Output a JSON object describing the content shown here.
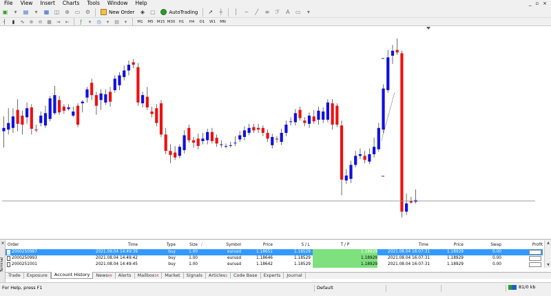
{
  "menu": {
    "items": [
      "File",
      "View",
      "Insert",
      "Charts",
      "Tools",
      "Window",
      "Help"
    ],
    "window_controls": [
      "_",
      "▫",
      "×"
    ]
  },
  "toolbar": {
    "new_order_label": "New Order",
    "autotrading_label": "AutoTrading",
    "timeframes": [
      "M1",
      "M5",
      "M15",
      "M30",
      "H1",
      "H4",
      "D1",
      "W1",
      "MN"
    ]
  },
  "chart": {
    "colors": {
      "bull": "#1010e0",
      "bear": "#ee1111",
      "background": "#ffffff",
      "line": "#8c8c8c"
    },
    "candles": [
      {
        "o": 183.2,
        "c": 183.6,
        "h": 185.0,
        "l": 181.2
      },
      {
        "o": 183.4,
        "c": 184.2,
        "h": 186.0,
        "l": 182.8
      },
      {
        "o": 183.6,
        "c": 185.0,
        "h": 186.0,
        "l": 183.0
      },
      {
        "o": 185.8,
        "c": 184.1,
        "h": 187.1,
        "l": 183.2
      },
      {
        "o": 185.1,
        "c": 184.0,
        "h": 185.7,
        "l": 182.8
      },
      {
        "o": 184.9,
        "c": 186.0,
        "h": 186.7,
        "l": 184.1
      },
      {
        "o": 186.1,
        "c": 183.5,
        "h": 186.5,
        "l": 182.8
      },
      {
        "o": 183.4,
        "c": 183.3,
        "h": 184.0,
        "l": 183.1
      },
      {
        "o": 184.2,
        "c": 185.1,
        "h": 185.6,
        "l": 183.8
      },
      {
        "o": 183.9,
        "c": 185.4,
        "h": 186.3,
        "l": 183.6
      },
      {
        "o": 184.7,
        "c": 187.2,
        "h": 187.5,
        "l": 184.4
      },
      {
        "o": 185.4,
        "c": 187.6,
        "h": 188.7,
        "l": 185.2
      },
      {
        "o": 187.0,
        "c": 185.5,
        "h": 187.5,
        "l": 185.2
      },
      {
        "o": 186.2,
        "c": 185.7,
        "h": 186.5,
        "l": 185.3
      },
      {
        "o": 185.9,
        "c": 186.1,
        "h": 186.5,
        "l": 185.7
      },
      {
        "o": 185.1,
        "c": 185.6,
        "h": 186.2,
        "l": 184.9
      },
      {
        "o": 186.3,
        "c": 184.0,
        "h": 186.6,
        "l": 183.7
      },
      {
        "o": 186.6,
        "c": 186.8,
        "h": 187.0,
        "l": 185.5
      },
      {
        "o": 187.3,
        "c": 188.3,
        "h": 188.6,
        "l": 186.7
      },
      {
        "o": 189.1,
        "c": 187.6,
        "h": 189.6,
        "l": 187.0
      },
      {
        "o": 187.6,
        "c": 186.3,
        "h": 188.0,
        "l": 185.2
      },
      {
        "o": 187.0,
        "c": 187.8,
        "h": 188.3,
        "l": 185.8
      },
      {
        "o": 186.7,
        "c": 187.7,
        "h": 188.3,
        "l": 186.4
      },
      {
        "o": 188.0,
        "c": 186.8,
        "h": 188.6,
        "l": 186.2
      },
      {
        "o": 188.2,
        "c": 189.6,
        "h": 190.0,
        "l": 187.9
      },
      {
        "o": 188.8,
        "c": 190.0,
        "h": 190.4,
        "l": 188.2
      },
      {
        "o": 189.8,
        "c": 190.6,
        "h": 191.2,
        "l": 189.4
      },
      {
        "o": 190.6,
        "c": 191.3,
        "h": 191.8,
        "l": 190.0
      },
      {
        "o": 191.6,
        "c": 191.3,
        "h": 192.0,
        "l": 190.9
      },
      {
        "o": 191.0,
        "c": 186.7,
        "h": 191.5,
        "l": 186.3
      },
      {
        "o": 186.6,
        "c": 187.6,
        "h": 188.0,
        "l": 186.1
      },
      {
        "o": 187.4,
        "c": 186.1,
        "h": 188.6,
        "l": 185.8
      },
      {
        "o": 185.6,
        "c": 185.3,
        "h": 186.2,
        "l": 184.9
      },
      {
        "o": 186.0,
        "c": 184.2,
        "h": 186.5,
        "l": 183.8
      },
      {
        "o": 186.6,
        "c": 182.8,
        "h": 187.0,
        "l": 182.5
      },
      {
        "o": 182.8,
        "c": 180.8,
        "h": 183.6,
        "l": 180.4
      },
      {
        "o": 180.8,
        "c": 180.3,
        "h": 181.6,
        "l": 179.3
      },
      {
        "o": 180.6,
        "c": 180.0,
        "h": 181.4,
        "l": 179.7
      },
      {
        "o": 180.2,
        "c": 181.3,
        "h": 181.6,
        "l": 179.9
      },
      {
        "o": 180.9,
        "c": 182.7,
        "h": 183.3,
        "l": 180.5
      },
      {
        "o": 183.6,
        "c": 182.1,
        "h": 184.0,
        "l": 181.8
      },
      {
        "o": 182.1,
        "c": 181.8,
        "h": 182.5,
        "l": 181.2
      },
      {
        "o": 182.3,
        "c": 181.4,
        "h": 182.9,
        "l": 181.0
      },
      {
        "o": 182.0,
        "c": 182.3,
        "h": 183.0,
        "l": 181.6
      },
      {
        "o": 182.1,
        "c": 183.1,
        "h": 183.5,
        "l": 181.6
      },
      {
        "o": 183.1,
        "c": 182.0,
        "h": 183.6,
        "l": 181.7
      },
      {
        "o": 182.4,
        "c": 181.7,
        "h": 182.8,
        "l": 181.3
      },
      {
        "o": 181.6,
        "c": 181.6,
        "h": 182.1,
        "l": 181.2
      },
      {
        "o": 181.4,
        "c": 181.4,
        "h": 181.7,
        "l": 181.1
      },
      {
        "o": 181.5,
        "c": 181.5,
        "h": 181.9,
        "l": 181.2
      },
      {
        "o": 181.8,
        "c": 181.8,
        "h": 182.6,
        "l": 181.4
      },
      {
        "o": 182.2,
        "c": 182.7,
        "h": 183.2,
        "l": 181.9
      },
      {
        "o": 182.5,
        "c": 183.3,
        "h": 183.8,
        "l": 182.1
      },
      {
        "o": 183.0,
        "c": 183.6,
        "h": 184.1,
        "l": 182.7
      },
      {
        "o": 183.7,
        "c": 183.3,
        "h": 184.1,
        "l": 183.0
      },
      {
        "o": 183.6,
        "c": 183.4,
        "h": 184.1,
        "l": 183.0
      },
      {
        "o": 183.6,
        "c": 183.0,
        "h": 183.9,
        "l": 182.6
      },
      {
        "o": 183.0,
        "c": 182.3,
        "h": 183.4,
        "l": 181.9
      },
      {
        "o": 181.5,
        "c": 182.5,
        "h": 182.9,
        "l": 181.1
      },
      {
        "o": 182.3,
        "c": 182.2,
        "h": 182.6,
        "l": 181.8
      },
      {
        "o": 181.9,
        "c": 183.0,
        "h": 183.5,
        "l": 181.5
      },
      {
        "o": 183.0,
        "c": 184.0,
        "h": 184.5,
        "l": 182.6
      },
      {
        "o": 184.4,
        "c": 184.4,
        "h": 184.9,
        "l": 183.9
      },
      {
        "o": 184.3,
        "c": 185.4,
        "h": 185.9,
        "l": 183.9
      },
      {
        "o": 185.8,
        "c": 184.8,
        "h": 186.2,
        "l": 184.5
      },
      {
        "o": 184.5,
        "c": 184.2,
        "h": 184.9,
        "l": 183.8
      },
      {
        "o": 184.1,
        "c": 185.1,
        "h": 185.5,
        "l": 183.6
      },
      {
        "o": 185.0,
        "c": 184.4,
        "h": 185.8,
        "l": 184.1
      },
      {
        "o": 184.6,
        "c": 185.7,
        "h": 186.2,
        "l": 184.0
      },
      {
        "o": 184.6,
        "c": 185.6,
        "h": 186.1,
        "l": 184.2
      },
      {
        "o": 184.6,
        "c": 186.7,
        "h": 187.1,
        "l": 184.3
      },
      {
        "o": 186.6,
        "c": 184.0,
        "h": 187.1,
        "l": 183.4
      },
      {
        "o": 186.3,
        "c": 184.0,
        "h": 186.6,
        "l": 183.7
      },
      {
        "o": 183.9,
        "c": 177.3,
        "h": 184.5,
        "l": 175.4
      },
      {
        "o": 177.2,
        "c": 177.8,
        "h": 178.6,
        "l": 176.8
      },
      {
        "o": 177.4,
        "c": 179.1,
        "h": 179.6,
        "l": 176.9
      },
      {
        "o": 179.1,
        "c": 180.2,
        "h": 180.8,
        "l": 178.8
      },
      {
        "o": 180.2,
        "c": 180.4,
        "h": 181.1,
        "l": 179.8
      },
      {
        "o": 180.2,
        "c": 179.7,
        "h": 180.8,
        "l": 179.3
      },
      {
        "o": 179.5,
        "c": 180.4,
        "h": 181.1,
        "l": 179.2
      },
      {
        "o": 180.4,
        "c": 181.3,
        "h": 182.4,
        "l": 180.0
      },
      {
        "o": 181.0,
        "c": 183.6,
        "h": 184.2,
        "l": 180.7
      },
      {
        "o": 183.4,
        "c": 188.4,
        "h": 188.9,
        "l": 183.0
      },
      {
        "o": 188.2,
        "c": 192.2,
        "h": 193.1,
        "l": 187.9
      },
      {
        "o": 192.4,
        "c": 193.0,
        "h": 193.7,
        "l": 191.4
      },
      {
        "o": 193.1,
        "c": 192.8,
        "h": 194.5,
        "l": 192.5
      },
      {
        "o": 192.7,
        "c": 173.4,
        "h": 193.0,
        "l": 172.7
      },
      {
        "o": 173.4,
        "c": 174.4,
        "h": 175.6,
        "l": 173.0
      },
      {
        "o": 174.7,
        "c": 174.5,
        "h": 175.2,
        "l": 174.4
      },
      {
        "o": 174.6,
        "c": 174.8,
        "h": 176.1,
        "l": 174.4
      }
    ],
    "line_level": 174.7
  },
  "terminal": {
    "side_label": "Terminal",
    "columns": [
      "Order",
      "Time",
      "Type",
      "Size",
      "Symbol",
      "Price",
      "S / L",
      "T / P",
      "Time",
      "Price",
      "Swap",
      "Profit"
    ],
    "rows": [
      [
        "2000250987",
        "2021.08.04 14:49:39",
        "buy",
        "1.00",
        "eurusd",
        "1.18651",
        "1.18529",
        "1.18929",
        "2021.08.04 16:07:31",
        "1.18929",
        "0.00",
        ""
      ],
      [
        "2000250993",
        "2021.08.04 14:49:42",
        "buy",
        "1.00",
        "eurusd",
        "1.18646",
        "1.18529",
        "1.18929",
        "2021.08.04 16:07:31",
        "1.18929",
        "0.00",
        ""
      ],
      [
        "2000251001",
        "2021.08.04 14:49:45",
        "buy",
        "1.00",
        "eurusd",
        "1.18642",
        "1.18529",
        "1.18929",
        "2021.08.04 16:07:31",
        "1.18929",
        "0.00",
        ""
      ]
    ],
    "selected_row": 0
  },
  "tabs": [
    {
      "label": "Trade",
      "badge": ""
    },
    {
      "label": "Exposure",
      "badge": ""
    },
    {
      "label": "Account History",
      "badge": "",
      "active": true
    },
    {
      "label": "News",
      "badge": "99"
    },
    {
      "label": "Alerts",
      "badge": ""
    },
    {
      "label": "Mailbox",
      "badge": "59"
    },
    {
      "label": "Market",
      "badge": ""
    },
    {
      "label": "Signals",
      "badge": ""
    },
    {
      "label": "Articles",
      "badge": "3"
    },
    {
      "label": "Code Base",
      "badge": ""
    },
    {
      "label": "Experts",
      "badge": ""
    },
    {
      "label": "Journal",
      "badge": ""
    }
  ],
  "status": {
    "help": "For Help, press F1",
    "profile": "Default",
    "traffic": "81/0 kb"
  }
}
